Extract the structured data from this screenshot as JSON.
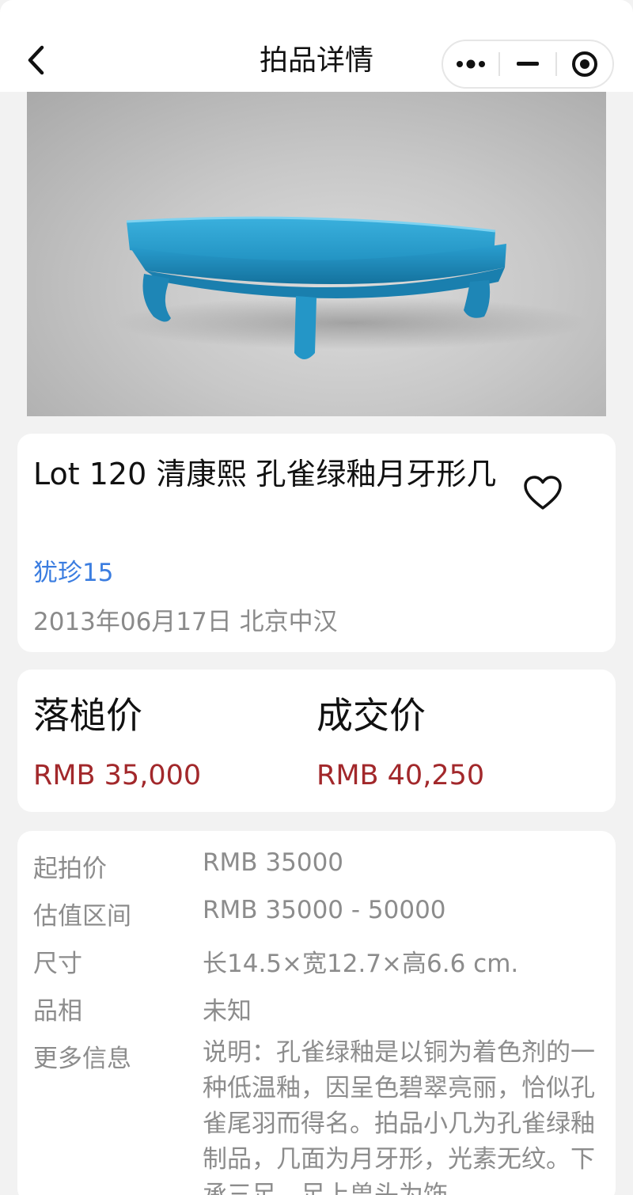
{
  "nav": {
    "title": "拍品详情",
    "back_icon": "chevron-left-icon",
    "more_icon": "more-dots-icon",
    "minimize_icon": "minus-icon",
    "close_icon": "target-circle-icon"
  },
  "hero": {
    "image_alt": "turquoise crescent-shaped stand"
  },
  "lot": {
    "title": "Lot 120 清康熙 孔雀绿釉月牙形几",
    "seller": "犹珍15",
    "date_location": "2013年06月17日 北京中汉",
    "favorite_icon": "heart-icon"
  },
  "prices": {
    "hammer_label": "落槌价",
    "hammer_value": "RMB 35,000",
    "deal_label": "成交价",
    "deal_value": "RMB 40,250"
  },
  "details": {
    "start_price_label": "起拍价",
    "start_price": "RMB 35000",
    "estimate_label": "估值区间",
    "estimate": "RMB 35000 - 50000",
    "size_label": "尺寸",
    "size": "长14.5×宽12.7×高6.6 cm.",
    "condition_label": "品相",
    "condition": "未知",
    "more_label": "更多信息",
    "more": "说明：孔雀绿釉是以铜为着色剂的一种低温釉，因呈色碧翠亮丽，恰似孔雀尾羽而得名。拍品小几为孔雀绿釉制品，几面为月牙形，光素无纹。下承三足，足上兽头为饰，"
  },
  "colors": {
    "accent_blue": "#3b7de0",
    "price_red": "#a2282b",
    "muted_text": "#8c8c8c",
    "glaze_turquoise": "#1f8fbf"
  }
}
